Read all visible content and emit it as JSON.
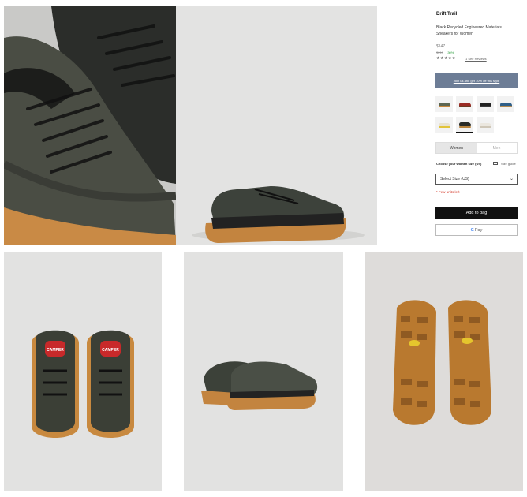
{
  "product": {
    "title": "Drift Trail",
    "subtitle": "Black Recycled Engineered Materials Sneakers for Women",
    "price": "$147",
    "old_price": "$210",
    "discount": "-30%",
    "rating_stars": "★★★★★",
    "reviews_link": "1 See Reviews"
  },
  "promo": {
    "label": "Join us and get 10% off this style"
  },
  "swatches": [
    {
      "name": "olive-orange",
      "upper": "#5d6652",
      "sole": "#c8873b"
    },
    {
      "name": "red",
      "upper": "#9a2b24",
      "sole": "#6b3b22"
    },
    {
      "name": "black",
      "upper": "#222222",
      "sole": "#3a3a3a"
    },
    {
      "name": "blue",
      "upper": "#2f5f88",
      "sole": "#b48a4e"
    },
    {
      "name": "white-yellow",
      "upper": "#e8e2cf",
      "sole": "#e2c43a"
    },
    {
      "name": "black-selected",
      "upper": "#2a2c28",
      "sole": "#b8843e"
    },
    {
      "name": "white",
      "upper": "#ebe7df",
      "sole": "#cfc7b8"
    }
  ],
  "gender": {
    "women": "Women",
    "men": "Men"
  },
  "size": {
    "label": "Choose your women size (US)",
    "guide": "Size guide",
    "select_value": "Select Size (US)"
  },
  "stock_note": "* Few units left",
  "buttons": {
    "add_to_bag": "Add to bag",
    "gpay_g": "G",
    "gpay_text": "Pay"
  },
  "photos": {
    "top_view_logo_left": "CAMPER",
    "top_view_logo_right": "CAMPER"
  },
  "colors": {
    "accent_promo": "#6d7d96",
    "add_to_bag": "#111111",
    "stock_warning": "#d43a2a",
    "discount": "#2a9d3a"
  }
}
